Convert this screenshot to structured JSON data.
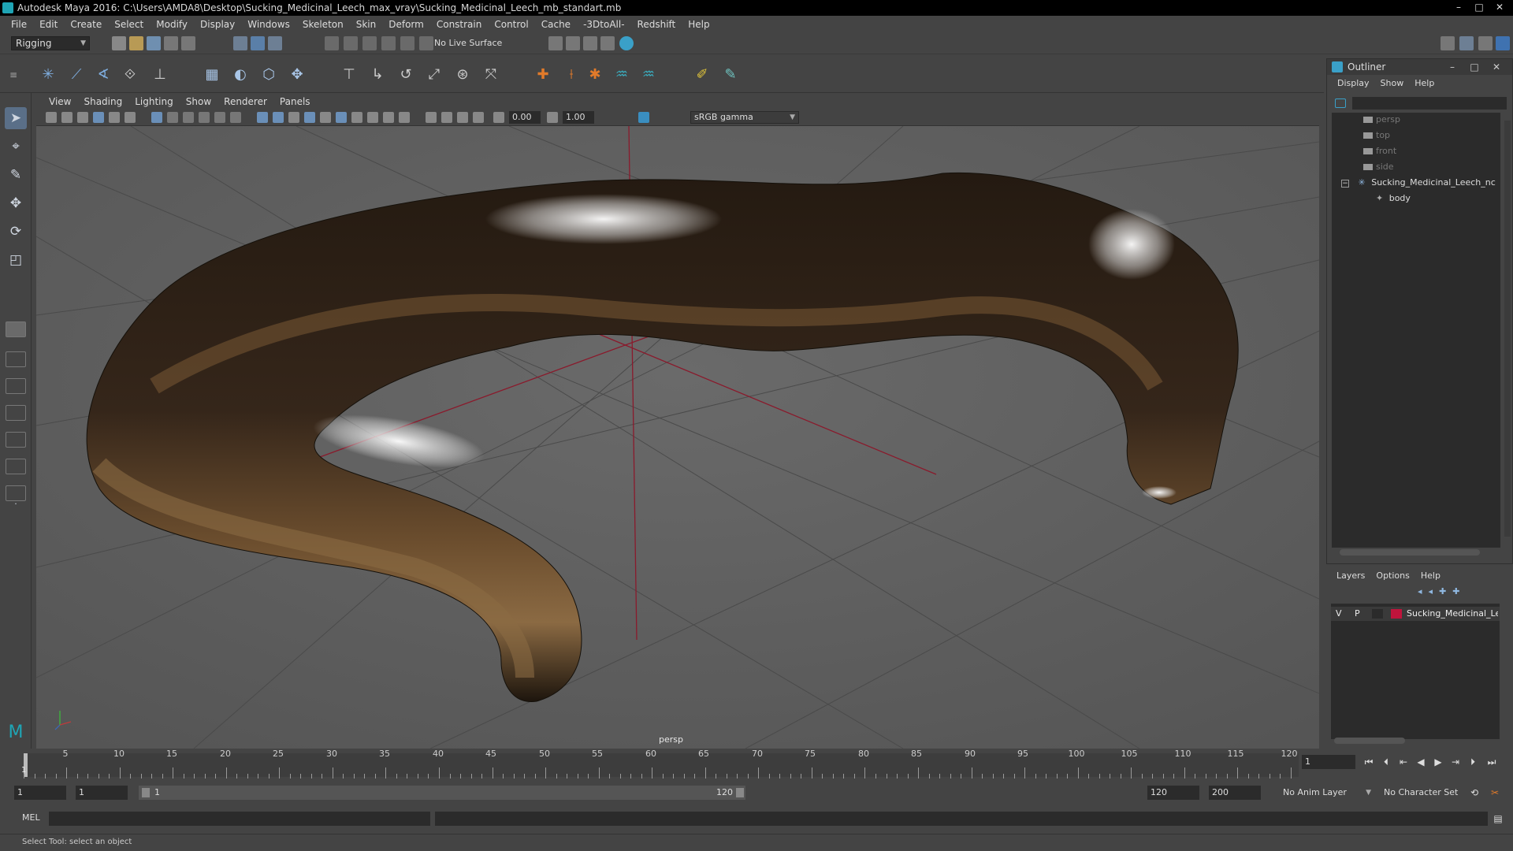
{
  "window": {
    "title": "Autodesk Maya 2016: C:\\Users\\AMDA8\\Desktop\\Sucking_Medicinal_Leech_max_vray\\Sucking_Medicinal_Leech_mb_standart.mb",
    "minimize": "–",
    "maximize": "□",
    "close": "✕"
  },
  "menubar": [
    "File",
    "Edit",
    "Create",
    "Select",
    "Modify",
    "Display",
    "Windows",
    "Skeleton",
    "Skin",
    "Deform",
    "Constrain",
    "Control",
    "Cache",
    "-3DtoAll-",
    "Redshift",
    "Help"
  ],
  "statusline": {
    "mode": "Rigging",
    "live_surface": "No Live Surface"
  },
  "viewport": {
    "menu": [
      "View",
      "Shading",
      "Lighting",
      "Show",
      "Renderer",
      "Panels"
    ],
    "exposure": "0.00",
    "gamma": "1.00",
    "color_space": "sRGB gamma",
    "camera": "persp"
  },
  "outliner": {
    "title": "Outliner",
    "menu": [
      "Display",
      "Show",
      "Help"
    ],
    "items": [
      {
        "label": "persp"
      },
      {
        "label": "top"
      },
      {
        "label": "front"
      },
      {
        "label": "side"
      },
      {
        "label": "Sucking_Medicinal_Leech_nc"
      },
      {
        "label": "body"
      }
    ]
  },
  "layers": {
    "menu": [
      "Layers",
      "Options",
      "Help"
    ],
    "row": {
      "v": "V",
      "p": "P",
      "name": "Sucking_Medicinal_Le",
      "color": "#c0143c"
    }
  },
  "timeline": {
    "ticks": [
      "5",
      "10",
      "15",
      "20",
      "25",
      "30",
      "35",
      "40",
      "45",
      "50",
      "55",
      "60",
      "65",
      "70",
      "75",
      "80",
      "85",
      "90",
      "95",
      "100",
      "105",
      "110",
      "115",
      "120"
    ],
    "cursor_label": "1",
    "current_frame": "1"
  },
  "range": {
    "start": "1",
    "playback_start": "1",
    "bar_start": "1",
    "bar_end": "120",
    "playback_end": "120",
    "end": "200",
    "anim_layer": "No Anim Layer",
    "character_set": "No Character Set"
  },
  "cmdline": {
    "label": "MEL"
  },
  "helpline": {
    "text": "Select Tool: select an object"
  },
  "colors": {
    "accent": "#5a6f88",
    "layer_color": "#c0143c",
    "viewport_bg": "#5e5e5e"
  }
}
